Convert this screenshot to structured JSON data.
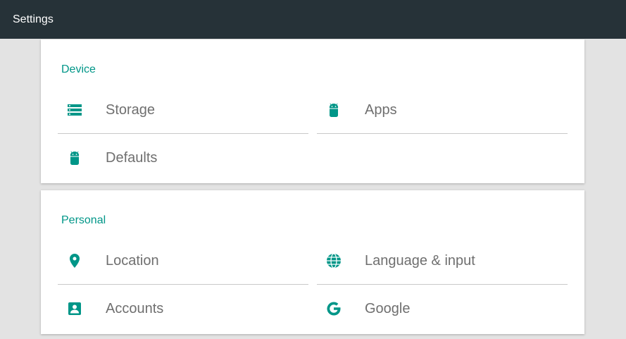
{
  "app_bar": {
    "title": "Settings",
    "background": "#263238"
  },
  "accent_color": "#009688",
  "sections": [
    {
      "title": "Device",
      "items": [
        {
          "label": "Storage",
          "icon": "storage-icon"
        },
        {
          "label": "Apps",
          "icon": "android-icon"
        },
        {
          "label": "Defaults",
          "icon": "android-icon"
        }
      ]
    },
    {
      "title": "Personal",
      "items": [
        {
          "label": "Location",
          "icon": "location-pin-icon"
        },
        {
          "label": "Language & input",
          "icon": "globe-icon"
        },
        {
          "label": "Accounts",
          "icon": "account-box-icon"
        },
        {
          "label": "Google",
          "icon": "google-icon"
        }
      ]
    }
  ]
}
